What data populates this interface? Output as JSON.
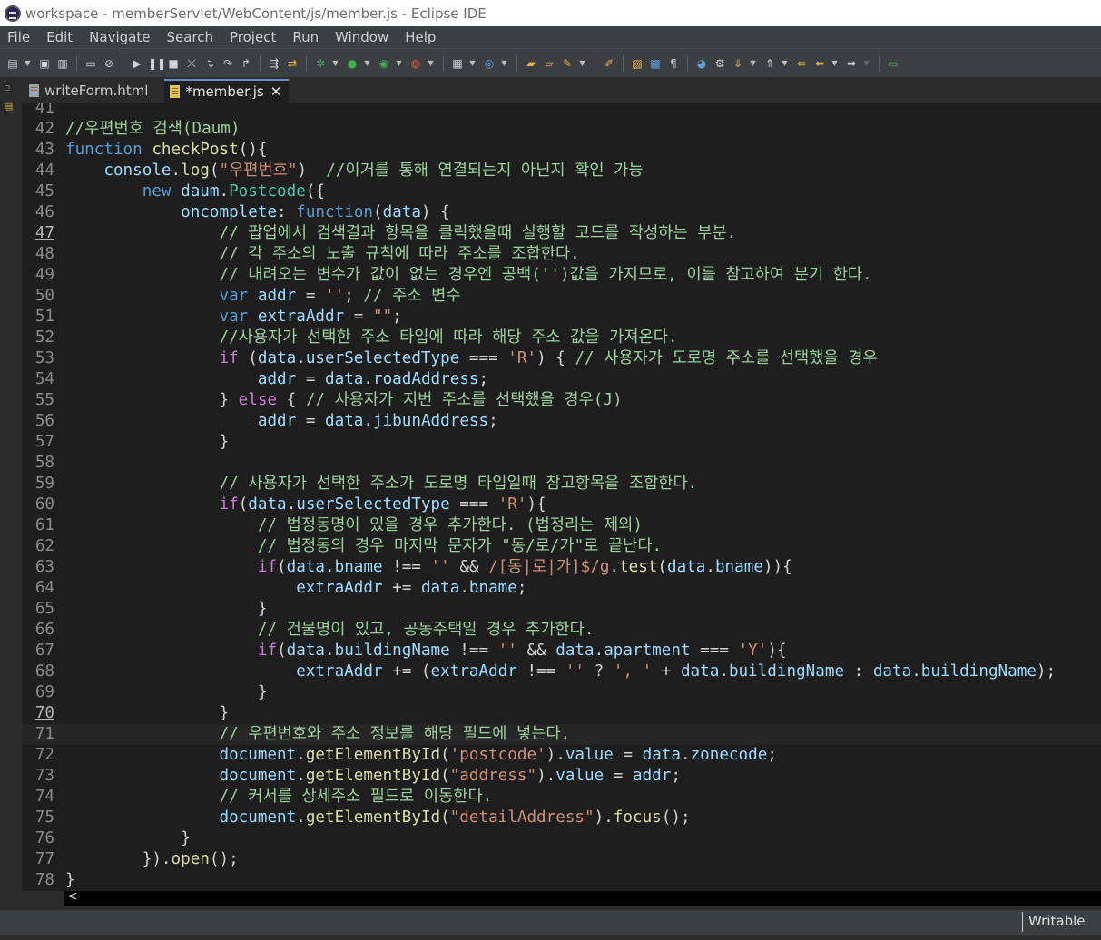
{
  "window": {
    "title": "workspace - memberServlet/WebContent/js/member.js - Eclipse IDE"
  },
  "menu": [
    "File",
    "Edit",
    "Navigate",
    "Search",
    "Project",
    "Run",
    "Window",
    "Help"
  ],
  "tabs": [
    {
      "label": "writeForm.html",
      "active": false
    },
    {
      "label": "*member.js",
      "active": true
    }
  ],
  "editor": {
    "current_line": 71,
    "colors": {
      "comment": "#9bd19b",
      "keyword": "#cc7ad8",
      "function": "#dcdcaa",
      "variable": "#9cdcfe",
      "string": "#ce9178",
      "default": "#d4d4d4",
      "number": "#b5cea8"
    },
    "lines": [
      {
        "n": 41,
        "tokens": []
      },
      {
        "n": 42,
        "tokens": [
          [
            "c",
            "//우편번호 검색(Daum)"
          ]
        ]
      },
      {
        "n": 43,
        "tokens": [
          [
            "b",
            "function "
          ],
          [
            "f",
            "checkPost"
          ],
          [
            "p",
            "(){"
          ]
        ]
      },
      {
        "n": 44,
        "tokens": [
          [
            "p",
            "    "
          ],
          [
            "v",
            "console"
          ],
          [
            "p",
            "."
          ],
          [
            "f",
            "log"
          ],
          [
            "p",
            "("
          ],
          [
            "s",
            "\"우편번호\""
          ],
          [
            "p",
            ")  "
          ],
          [
            "c",
            "//이거를 통해 연결되는지 아닌지 확인 가능"
          ]
        ]
      },
      {
        "n": 45,
        "tokens": [
          [
            "p",
            "        "
          ],
          [
            "b",
            "new "
          ],
          [
            "v",
            "daum"
          ],
          [
            "p",
            "."
          ],
          [
            "g",
            "Postcode"
          ],
          [
            "p",
            "({"
          ]
        ]
      },
      {
        "n": 46,
        "tokens": [
          [
            "p",
            "            "
          ],
          [
            "v",
            "oncomplete"
          ],
          [
            "p",
            ": "
          ],
          [
            "b",
            "function"
          ],
          [
            "p",
            "("
          ],
          [
            "v",
            "data"
          ],
          [
            "p",
            ") {"
          ]
        ]
      },
      {
        "n": 47,
        "u": true,
        "tokens": [
          [
            "p",
            "                "
          ],
          [
            "c",
            "// 팝업에서 검색결과 항목을 클릭했을때 실행할 코드를 작성하는 부분."
          ]
        ]
      },
      {
        "n": 48,
        "tokens": [
          [
            "p",
            "                "
          ],
          [
            "c",
            "// 각 주소의 노출 규칙에 따라 주소를 조합한다."
          ]
        ]
      },
      {
        "n": 49,
        "tokens": [
          [
            "p",
            "                "
          ],
          [
            "c",
            "// 내려오는 변수가 값이 없는 경우엔 공백('')값을 가지므로, 이를 참고하여 분기 한다."
          ]
        ]
      },
      {
        "n": 50,
        "tokens": [
          [
            "p",
            "                "
          ],
          [
            "b",
            "var "
          ],
          [
            "v",
            "addr"
          ],
          [
            "p",
            " = "
          ],
          [
            "s",
            "''"
          ],
          [
            "p",
            "; "
          ],
          [
            "c",
            "// 주소 변수"
          ]
        ]
      },
      {
        "n": 51,
        "tokens": [
          [
            "p",
            "                "
          ],
          [
            "b",
            "var "
          ],
          [
            "v",
            "extraAddr"
          ],
          [
            "p",
            " = "
          ],
          [
            "s",
            "\"\""
          ],
          [
            "p",
            ";"
          ]
        ]
      },
      {
        "n": 52,
        "tokens": [
          [
            "p",
            "                "
          ],
          [
            "c",
            "//사용자가 선택한 주소 타입에 따라 해당 주소 값을 가져온다."
          ]
        ]
      },
      {
        "n": 53,
        "tokens": [
          [
            "p",
            "                "
          ],
          [
            "k",
            "if"
          ],
          [
            "p",
            " ("
          ],
          [
            "v",
            "data"
          ],
          [
            "p",
            "."
          ],
          [
            "v",
            "userSelectedType"
          ],
          [
            "p",
            " === "
          ],
          [
            "s",
            "'R'"
          ],
          [
            "p",
            ") { "
          ],
          [
            "c",
            "// 사용자가 도로명 주소를 선택했을 경우"
          ]
        ]
      },
      {
        "n": 54,
        "tokens": [
          [
            "p",
            "                    "
          ],
          [
            "v",
            "addr"
          ],
          [
            "p",
            " = "
          ],
          [
            "v",
            "data"
          ],
          [
            "p",
            "."
          ],
          [
            "v",
            "roadAddress"
          ],
          [
            "p",
            ";"
          ]
        ]
      },
      {
        "n": 55,
        "tokens": [
          [
            "p",
            "                } "
          ],
          [
            "k",
            "else"
          ],
          [
            "p",
            " { "
          ],
          [
            "c",
            "// 사용자가 지번 주소를 선택했을 경우(J)"
          ]
        ]
      },
      {
        "n": 56,
        "tokens": [
          [
            "p",
            "                    "
          ],
          [
            "v",
            "addr"
          ],
          [
            "p",
            " = "
          ],
          [
            "v",
            "data"
          ],
          [
            "p",
            "."
          ],
          [
            "v",
            "jibunAddress"
          ],
          [
            "p",
            ";"
          ]
        ]
      },
      {
        "n": 57,
        "tokens": [
          [
            "p",
            "                }"
          ]
        ]
      },
      {
        "n": 58,
        "tokens": []
      },
      {
        "n": 59,
        "tokens": [
          [
            "p",
            "                "
          ],
          [
            "c",
            "// 사용자가 선택한 주소가 도로명 타입일때 참고항목을 조합한다."
          ]
        ]
      },
      {
        "n": 60,
        "tokens": [
          [
            "p",
            "                "
          ],
          [
            "k",
            "if"
          ],
          [
            "p",
            "("
          ],
          [
            "v",
            "data"
          ],
          [
            "p",
            "."
          ],
          [
            "v",
            "userSelectedType"
          ],
          [
            "p",
            " === "
          ],
          [
            "s",
            "'R'"
          ],
          [
            "p",
            "){"
          ]
        ]
      },
      {
        "n": 61,
        "tokens": [
          [
            "p",
            "                    "
          ],
          [
            "c",
            "// 법정동명이 있을 경우 추가한다. (법정리는 제외)"
          ]
        ]
      },
      {
        "n": 62,
        "tokens": [
          [
            "p",
            "                    "
          ],
          [
            "c",
            "// 법정동의 경우 마지막 문자가 \"동/로/가\"로 끝난다."
          ]
        ]
      },
      {
        "n": 63,
        "tokens": [
          [
            "p",
            "                    "
          ],
          [
            "k",
            "if"
          ],
          [
            "p",
            "("
          ],
          [
            "v",
            "data"
          ],
          [
            "p",
            "."
          ],
          [
            "v",
            "bname"
          ],
          [
            "p",
            " !== "
          ],
          [
            "s",
            "''"
          ],
          [
            "p",
            " && "
          ],
          [
            "s",
            "/[동|로|가]$/g"
          ],
          [
            "p",
            "."
          ],
          [
            "f",
            "test"
          ],
          [
            "p",
            "("
          ],
          [
            "v",
            "data"
          ],
          [
            "p",
            "."
          ],
          [
            "v",
            "bname"
          ],
          [
            "p",
            "))"
          ],
          [
            "p",
            "{"
          ]
        ]
      },
      {
        "n": 64,
        "tokens": [
          [
            "p",
            "                        "
          ],
          [
            "v",
            "extraAddr"
          ],
          [
            "p",
            " += "
          ],
          [
            "v",
            "data"
          ],
          [
            "p",
            "."
          ],
          [
            "v",
            "bname"
          ],
          [
            "p",
            ";"
          ]
        ]
      },
      {
        "n": 65,
        "tokens": [
          [
            "p",
            "                    }"
          ]
        ]
      },
      {
        "n": 66,
        "tokens": [
          [
            "p",
            "                    "
          ],
          [
            "c",
            "// 건물명이 있고, 공동주택일 경우 추가한다."
          ]
        ]
      },
      {
        "n": 67,
        "tokens": [
          [
            "p",
            "                    "
          ],
          [
            "k",
            "if"
          ],
          [
            "p",
            "("
          ],
          [
            "v",
            "data"
          ],
          [
            "p",
            "."
          ],
          [
            "v",
            "buildingName"
          ],
          [
            "p",
            " !== "
          ],
          [
            "s",
            "''"
          ],
          [
            "p",
            " && "
          ],
          [
            "v",
            "data"
          ],
          [
            "p",
            "."
          ],
          [
            "v",
            "apartment"
          ],
          [
            "p",
            " === "
          ],
          [
            "s",
            "'Y'"
          ],
          [
            "p",
            "){"
          ]
        ]
      },
      {
        "n": 68,
        "tokens": [
          [
            "p",
            "                        "
          ],
          [
            "v",
            "extraAddr"
          ],
          [
            "p",
            " += ("
          ],
          [
            "v",
            "extraAddr"
          ],
          [
            "p",
            " !== "
          ],
          [
            "s",
            "''"
          ],
          [
            "p",
            " ? "
          ],
          [
            "s",
            "', '"
          ],
          [
            "p",
            " + "
          ],
          [
            "v",
            "data"
          ],
          [
            "p",
            "."
          ],
          [
            "v",
            "buildingName"
          ],
          [
            "p",
            " : "
          ],
          [
            "v",
            "data"
          ],
          [
            "p",
            "."
          ],
          [
            "v",
            "buildingName"
          ],
          [
            "p",
            ");"
          ]
        ]
      },
      {
        "n": 69,
        "tokens": [
          [
            "p",
            "                    }"
          ]
        ]
      },
      {
        "n": 70,
        "u": true,
        "tokens": [
          [
            "p",
            "                }"
          ]
        ]
      },
      {
        "n": 71,
        "tokens": [
          [
            "p",
            "                "
          ],
          [
            "c",
            "// 우편번호와 주소 정보를 해당 필드에 넣는다."
          ]
        ]
      },
      {
        "n": 72,
        "tokens": [
          [
            "p",
            "                "
          ],
          [
            "v",
            "document"
          ],
          [
            "p",
            "."
          ],
          [
            "f",
            "getElementById"
          ],
          [
            "p",
            "("
          ],
          [
            "s",
            "'postcode'"
          ],
          [
            "p",
            ")."
          ],
          [
            "v",
            "value"
          ],
          [
            "p",
            " = "
          ],
          [
            "v",
            "data"
          ],
          [
            "p",
            "."
          ],
          [
            "v",
            "zonecode"
          ],
          [
            "p",
            ";"
          ]
        ]
      },
      {
        "n": 73,
        "tokens": [
          [
            "p",
            "                "
          ],
          [
            "v",
            "document"
          ],
          [
            "p",
            "."
          ],
          [
            "f",
            "getElementById"
          ],
          [
            "p",
            "("
          ],
          [
            "s",
            "\"address\""
          ],
          [
            "p",
            ")."
          ],
          [
            "v",
            "value"
          ],
          [
            "p",
            " = "
          ],
          [
            "v",
            "addr"
          ],
          [
            "p",
            ";"
          ]
        ]
      },
      {
        "n": 74,
        "tokens": [
          [
            "p",
            "                "
          ],
          [
            "c",
            "// 커서를 상세주소 필드로 이동한다."
          ]
        ]
      },
      {
        "n": 75,
        "tokens": [
          [
            "p",
            "                "
          ],
          [
            "v",
            "document"
          ],
          [
            "p",
            "."
          ],
          [
            "f",
            "getElementById"
          ],
          [
            "p",
            "("
          ],
          [
            "s",
            "\"detailAddress\""
          ],
          [
            "p",
            ")."
          ],
          [
            "f",
            "focus"
          ],
          [
            "p",
            "();"
          ]
        ]
      },
      {
        "n": 76,
        "tokens": [
          [
            "p",
            "            }"
          ]
        ]
      },
      {
        "n": 77,
        "tokens": [
          [
            "p",
            "        })."
          ],
          [
            "f",
            "open"
          ],
          [
            "p",
            "();"
          ]
        ]
      },
      {
        "n": 78,
        "tokens": [
          [
            "p",
            "}"
          ]
        ]
      }
    ]
  },
  "scrollbar": {
    "left_arrow_icon": "chevron-left-icon",
    "arrow_glyph": "<"
  },
  "status": {
    "mode": "Writable"
  }
}
